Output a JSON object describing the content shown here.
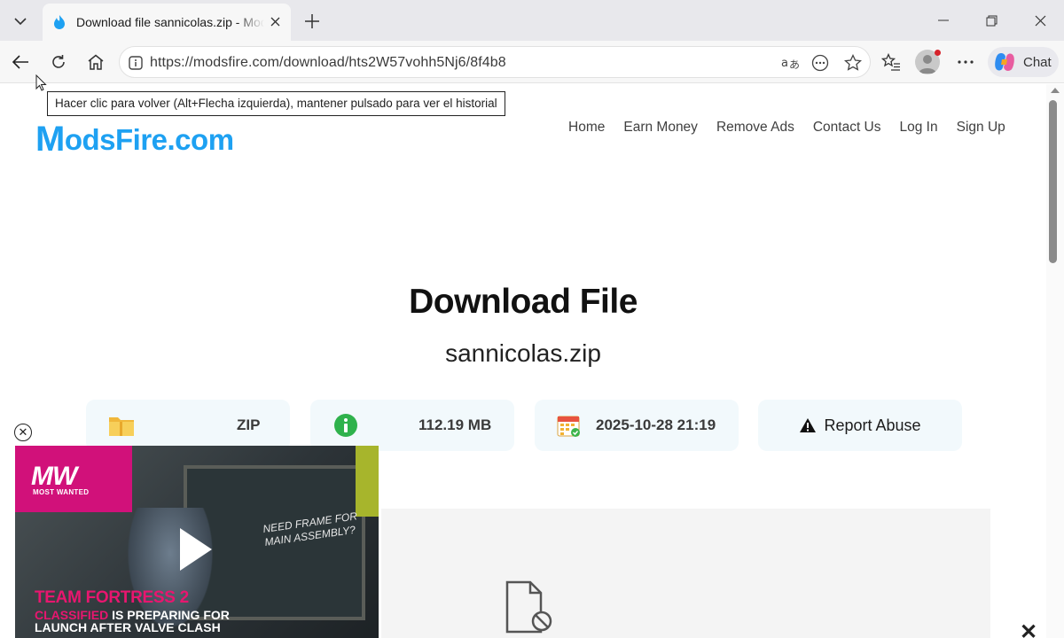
{
  "browser": {
    "tab_title": "Download file sannicolas.zip - ModsFire",
    "url": "https://modsfire.com/download/hts2W57vohh5Nj6/8f4b8",
    "chat_label": "Chat",
    "tooltip": "Hacer clic para volver (Alt+Flecha izquierda), mantener pulsado para ver el historial"
  },
  "site": {
    "logo_m": "M",
    "logo_rest": "odsFire.com",
    "nav": [
      "Home",
      "Earn Money",
      "Remove Ads",
      "Contact Us",
      "Log In",
      "Sign Up"
    ]
  },
  "download": {
    "title": "Download File",
    "filename": "sannicolas.zip",
    "file_type": "ZIP",
    "file_size": "112.19 MB",
    "date": "2025-10-28 21:19",
    "report_label": "Report Abuse"
  },
  "ad": {
    "logo": "MW",
    "logo_sub": "MOST WANTED",
    "board_text": "NEED FRAME FOR MAIN ASSEMBLY?",
    "headline": "TEAM FORTRESS 2",
    "sub_pink": "CLASSIFIED",
    "sub_white": " IS PREPARING FOR",
    "sub_line2": "LAUNCH AFTER VALVE CLASH"
  }
}
